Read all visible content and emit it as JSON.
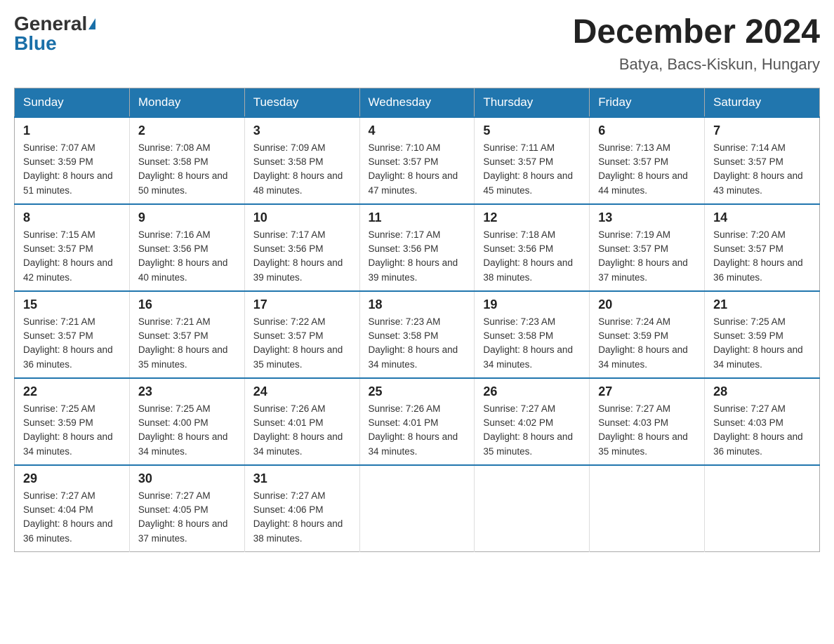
{
  "logo": {
    "general": "General",
    "blue": "Blue"
  },
  "title": "December 2024",
  "location": "Batya, Bacs-Kiskun, Hungary",
  "days_of_week": [
    "Sunday",
    "Monday",
    "Tuesday",
    "Wednesday",
    "Thursday",
    "Friday",
    "Saturday"
  ],
  "weeks": [
    [
      {
        "day": "1",
        "sunrise": "7:07 AM",
        "sunset": "3:59 PM",
        "daylight": "8 hours and 51 minutes."
      },
      {
        "day": "2",
        "sunrise": "7:08 AM",
        "sunset": "3:58 PM",
        "daylight": "8 hours and 50 minutes."
      },
      {
        "day": "3",
        "sunrise": "7:09 AM",
        "sunset": "3:58 PM",
        "daylight": "8 hours and 48 minutes."
      },
      {
        "day": "4",
        "sunrise": "7:10 AM",
        "sunset": "3:57 PM",
        "daylight": "8 hours and 47 minutes."
      },
      {
        "day": "5",
        "sunrise": "7:11 AM",
        "sunset": "3:57 PM",
        "daylight": "8 hours and 45 minutes."
      },
      {
        "day": "6",
        "sunrise": "7:13 AM",
        "sunset": "3:57 PM",
        "daylight": "8 hours and 44 minutes."
      },
      {
        "day": "7",
        "sunrise": "7:14 AM",
        "sunset": "3:57 PM",
        "daylight": "8 hours and 43 minutes."
      }
    ],
    [
      {
        "day": "8",
        "sunrise": "7:15 AM",
        "sunset": "3:57 PM",
        "daylight": "8 hours and 42 minutes."
      },
      {
        "day": "9",
        "sunrise": "7:16 AM",
        "sunset": "3:56 PM",
        "daylight": "8 hours and 40 minutes."
      },
      {
        "day": "10",
        "sunrise": "7:17 AM",
        "sunset": "3:56 PM",
        "daylight": "8 hours and 39 minutes."
      },
      {
        "day": "11",
        "sunrise": "7:17 AM",
        "sunset": "3:56 PM",
        "daylight": "8 hours and 39 minutes."
      },
      {
        "day": "12",
        "sunrise": "7:18 AM",
        "sunset": "3:56 PM",
        "daylight": "8 hours and 38 minutes."
      },
      {
        "day": "13",
        "sunrise": "7:19 AM",
        "sunset": "3:57 PM",
        "daylight": "8 hours and 37 minutes."
      },
      {
        "day": "14",
        "sunrise": "7:20 AM",
        "sunset": "3:57 PM",
        "daylight": "8 hours and 36 minutes."
      }
    ],
    [
      {
        "day": "15",
        "sunrise": "7:21 AM",
        "sunset": "3:57 PM",
        "daylight": "8 hours and 36 minutes."
      },
      {
        "day": "16",
        "sunrise": "7:21 AM",
        "sunset": "3:57 PM",
        "daylight": "8 hours and 35 minutes."
      },
      {
        "day": "17",
        "sunrise": "7:22 AM",
        "sunset": "3:57 PM",
        "daylight": "8 hours and 35 minutes."
      },
      {
        "day": "18",
        "sunrise": "7:23 AM",
        "sunset": "3:58 PM",
        "daylight": "8 hours and 34 minutes."
      },
      {
        "day": "19",
        "sunrise": "7:23 AM",
        "sunset": "3:58 PM",
        "daylight": "8 hours and 34 minutes."
      },
      {
        "day": "20",
        "sunrise": "7:24 AM",
        "sunset": "3:59 PM",
        "daylight": "8 hours and 34 minutes."
      },
      {
        "day": "21",
        "sunrise": "7:25 AM",
        "sunset": "3:59 PM",
        "daylight": "8 hours and 34 minutes."
      }
    ],
    [
      {
        "day": "22",
        "sunrise": "7:25 AM",
        "sunset": "3:59 PM",
        "daylight": "8 hours and 34 minutes."
      },
      {
        "day": "23",
        "sunrise": "7:25 AM",
        "sunset": "4:00 PM",
        "daylight": "8 hours and 34 minutes."
      },
      {
        "day": "24",
        "sunrise": "7:26 AM",
        "sunset": "4:01 PM",
        "daylight": "8 hours and 34 minutes."
      },
      {
        "day": "25",
        "sunrise": "7:26 AM",
        "sunset": "4:01 PM",
        "daylight": "8 hours and 34 minutes."
      },
      {
        "day": "26",
        "sunrise": "7:27 AM",
        "sunset": "4:02 PM",
        "daylight": "8 hours and 35 minutes."
      },
      {
        "day": "27",
        "sunrise": "7:27 AM",
        "sunset": "4:03 PM",
        "daylight": "8 hours and 35 minutes."
      },
      {
        "day": "28",
        "sunrise": "7:27 AM",
        "sunset": "4:03 PM",
        "daylight": "8 hours and 36 minutes."
      }
    ],
    [
      {
        "day": "29",
        "sunrise": "7:27 AM",
        "sunset": "4:04 PM",
        "daylight": "8 hours and 36 minutes."
      },
      {
        "day": "30",
        "sunrise": "7:27 AM",
        "sunset": "4:05 PM",
        "daylight": "8 hours and 37 minutes."
      },
      {
        "day": "31",
        "sunrise": "7:27 AM",
        "sunset": "4:06 PM",
        "daylight": "8 hours and 38 minutes."
      },
      null,
      null,
      null,
      null
    ]
  ]
}
